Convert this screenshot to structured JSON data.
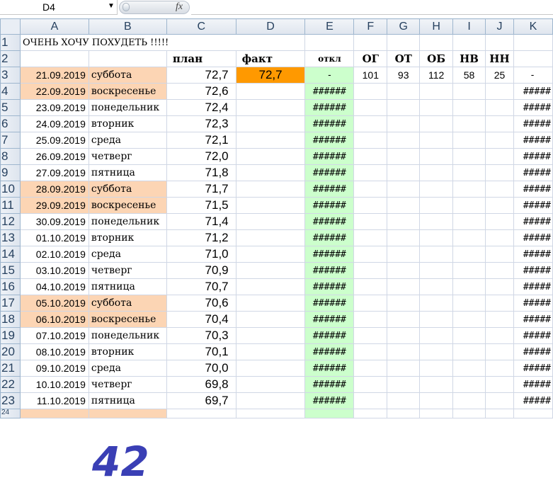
{
  "name_box": "D4",
  "formula_bar": {
    "fx_label": "fx",
    "value": ""
  },
  "columns": [
    "A",
    "B",
    "C",
    "D",
    "E",
    "F",
    "G",
    "H",
    "I",
    "J",
    "K"
  ],
  "title": "ОЧЕНЬ ХОЧУ ПОХУДЕТЬ !!!!!",
  "headers": {
    "plan": "план",
    "fact": "факт",
    "otkl": "откл",
    "og": "ОГ",
    "ot": "ОТ",
    "ob": "ОБ",
    "nv": "НВ",
    "nn": "НН"
  },
  "row3": {
    "og": "101",
    "ot": "93",
    "ob": "112",
    "nv": "58",
    "nn": "25",
    "k": "-"
  },
  "error_e": "######",
  "error_k": "#####",
  "rows": [
    {
      "num": "3",
      "date": "21.09.2019",
      "day": "суббота",
      "plan": "72,7",
      "fact": "72,7",
      "otkl": "-",
      "weekend": true
    },
    {
      "num": "4",
      "date": "22.09.2019",
      "day": "воскресенье",
      "plan": "72,6",
      "fact": "",
      "otkl": "######",
      "weekend": true
    },
    {
      "num": "5",
      "date": "23.09.2019",
      "day": "понедельник",
      "plan": "72,4",
      "fact": "",
      "otkl": "######",
      "weekend": false
    },
    {
      "num": "6",
      "date": "24.09.2019",
      "day": "вторник",
      "plan": "72,3",
      "fact": "",
      "otkl": "######",
      "weekend": false
    },
    {
      "num": "7",
      "date": "25.09.2019",
      "day": "среда",
      "plan": "72,1",
      "fact": "",
      "otkl": "######",
      "weekend": false
    },
    {
      "num": "8",
      "date": "26.09.2019",
      "day": "четверг",
      "plan": "72,0",
      "fact": "",
      "otkl": "######",
      "weekend": false
    },
    {
      "num": "9",
      "date": "27.09.2019",
      "day": "пятница",
      "plan": "71,8",
      "fact": "",
      "otkl": "######",
      "weekend": false
    },
    {
      "num": "10",
      "date": "28.09.2019",
      "day": "суббота",
      "plan": "71,7",
      "fact": "",
      "otkl": "######",
      "weekend": true
    },
    {
      "num": "11",
      "date": "29.09.2019",
      "day": "воскресенье",
      "plan": "71,5",
      "fact": "",
      "otkl": "######",
      "weekend": true
    },
    {
      "num": "12",
      "date": "30.09.2019",
      "day": "понедельник",
      "plan": "71,4",
      "fact": "",
      "otkl": "######",
      "weekend": false
    },
    {
      "num": "13",
      "date": "01.10.2019",
      "day": "вторник",
      "plan": "71,2",
      "fact": "",
      "otkl": "######",
      "weekend": false
    },
    {
      "num": "14",
      "date": "02.10.2019",
      "day": "среда",
      "plan": "71,0",
      "fact": "",
      "otkl": "######",
      "weekend": false
    },
    {
      "num": "15",
      "date": "03.10.2019",
      "day": "четверг",
      "plan": "70,9",
      "fact": "",
      "otkl": "######",
      "weekend": false
    },
    {
      "num": "16",
      "date": "04.10.2019",
      "day": "пятница",
      "plan": "70,7",
      "fact": "",
      "otkl": "######",
      "weekend": false
    },
    {
      "num": "17",
      "date": "05.10.2019",
      "day": "суббота",
      "plan": "70,6",
      "fact": "",
      "otkl": "######",
      "weekend": true
    },
    {
      "num": "18",
      "date": "06.10.2019",
      "day": "воскресенье",
      "plan": "70,4",
      "fact": "",
      "otkl": "######",
      "weekend": true
    },
    {
      "num": "19",
      "date": "07.10.2019",
      "day": "понедельник",
      "plan": "70,3",
      "fact": "",
      "otkl": "######",
      "weekend": false
    },
    {
      "num": "20",
      "date": "08.10.2019",
      "day": "вторник",
      "plan": "70,1",
      "fact": "",
      "otkl": "######",
      "weekend": false
    },
    {
      "num": "21",
      "date": "09.10.2019",
      "day": "среда",
      "plan": "70,0",
      "fact": "",
      "otkl": "######",
      "weekend": false
    },
    {
      "num": "22",
      "date": "10.10.2019",
      "day": "четверг",
      "plan": "69,8",
      "fact": "",
      "otkl": "######",
      "weekend": false
    },
    {
      "num": "23",
      "date": "11.10.2019",
      "day": "пятница",
      "plan": "69,7",
      "fact": "",
      "otkl": "######",
      "weekend": false
    }
  ],
  "partial_row": {
    "num": "24"
  },
  "handwritten_note": "42",
  "colors": {
    "weekend": "#fcd5b4",
    "fact_fill": "#ff9900",
    "otkl_fill": "#ccffcc",
    "grid_line": "#d0d7e5",
    "header_fill": "#e3e9f1",
    "ink": "#3a3fb5"
  }
}
